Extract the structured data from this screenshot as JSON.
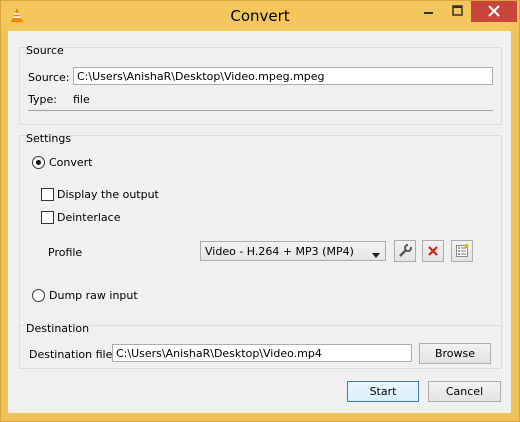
{
  "window": {
    "title": "Convert",
    "title_icon": "vlc-cone-icon"
  },
  "source": {
    "group_title": "Source",
    "source_label": "Source:",
    "source_value": "C:\\Users\\AnishaR\\Desktop\\Video.mpeg.mpeg",
    "type_label": "Type:",
    "type_value": "file"
  },
  "settings": {
    "group_title": "Settings",
    "convert_label": "Convert",
    "display_output_label": "Display the output",
    "deinterlace_label": "Deinterlace",
    "profile_label": "Profile",
    "profile_selected": "Video - H.264 + MP3 (MP4)",
    "dump_raw_label": "Dump raw input",
    "convert_selected": true,
    "display_output_checked": false,
    "deinterlace_checked": false,
    "dump_raw_selected": false
  },
  "destination": {
    "group_title": "Destination",
    "file_label": "Destination file:",
    "file_value": "C:\\Users\\AnishaR\\Desktop\\Video.mp4",
    "browse_label": "Browse"
  },
  "actions": {
    "start_label": "Start",
    "cancel_label": "Cancel"
  },
  "colors": {
    "title_bar": "#f4c75d",
    "close_button": "#c7453a",
    "delete_red": "#d0201c",
    "dialog_bg": "#f0f0f0"
  }
}
